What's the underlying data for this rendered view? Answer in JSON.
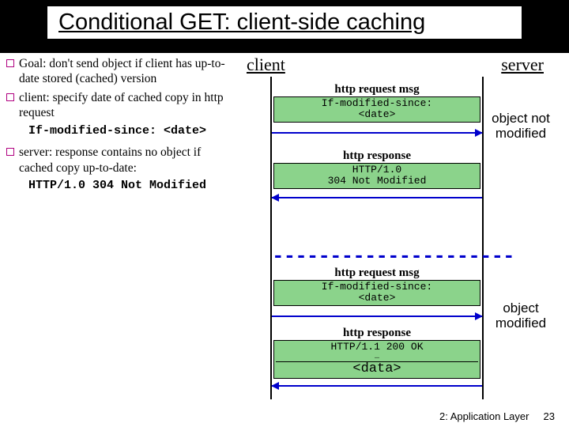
{
  "title": "Conditional GET: client-side caching",
  "bullets": {
    "b1": "Goal: don't send object if client has up-to-date stored (cached) version",
    "b2": "client: specify date of cached copy in http request",
    "b2_code": "If-modified-since: <date>",
    "b3": "server: response contains no object if cached copy up-to-date:",
    "b3_code": "HTTP/1.0 304 Not Modified"
  },
  "labels": {
    "client": "client",
    "server": "server",
    "obj_not_mod": "object not modified",
    "obj_mod": "object modified"
  },
  "msgs": {
    "req1_title": "http request msg",
    "req1_body1": "If-modified-since:",
    "req1_body2": "<date>",
    "resp1_title": "http response",
    "resp1_body1": "HTTP/1.0",
    "resp1_body2": "304 Not Modified",
    "req2_title": "http request msg",
    "req2_body1": "If-modified-since:",
    "req2_body2": "<date>",
    "resp2_title": "http response",
    "resp2_body1": "HTTP/1.1 200 OK",
    "resp2_body2": "…",
    "resp2_body3": "<data>"
  },
  "divider": "---------------------",
  "footer": {
    "chapter": "2: Application Layer",
    "page": "23"
  }
}
